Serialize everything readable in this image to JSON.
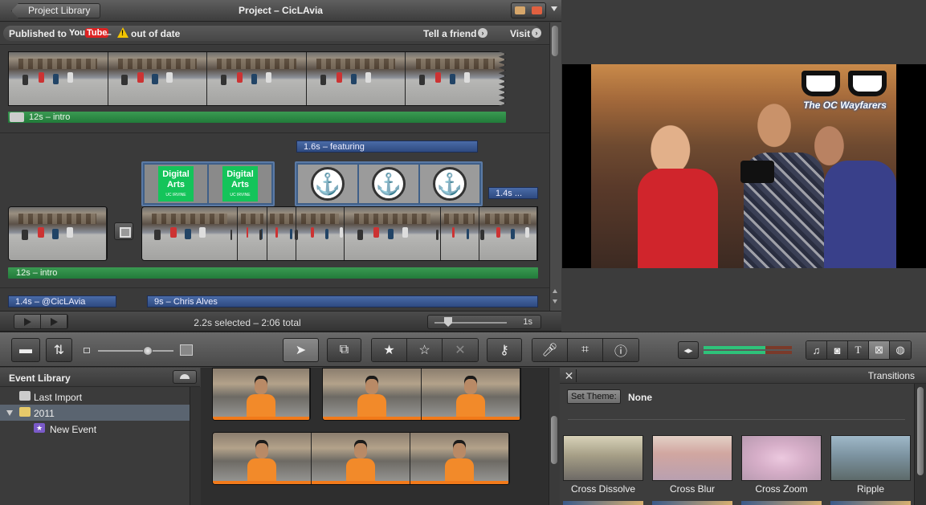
{
  "project": {
    "back_label": "Project Library",
    "title": "Project – CicLAvia",
    "published_to": "Published to",
    "youtube_you": "You",
    "youtube_tube": "Tube",
    "dash": "–",
    "status": "out of date",
    "tell_friend": "Tell a friend",
    "visit": "Visit"
  },
  "timeline": {
    "row1_clip": "12s – intro",
    "featuring": "1.6s – featuring",
    "short_clip": "1.4s ...",
    "row2_clip": "12s – intro",
    "title_left": "1.4s – @CicLAvia",
    "title_right": "9s – Chris Alves",
    "digital_arts_line1": "Digital",
    "digital_arts_line2": "Arts",
    "digital_arts_sub": "UC IRVINE"
  },
  "status_bar": {
    "selected": "2.2s selected – 2:06 total",
    "duration": "1s"
  },
  "viewer": {
    "logo_text": "The OC Wayfarers"
  },
  "event_library": {
    "title": "Event Library",
    "items": [
      {
        "label": "Last Import",
        "icon": "film-icon"
      },
      {
        "label": "2011",
        "icon": "calendar-icon"
      },
      {
        "label": "New Event",
        "icon": "star-icon"
      }
    ]
  },
  "transitions": {
    "title": "Transitions",
    "set_theme": "Set Theme:",
    "theme_value": "None",
    "items": [
      "Cross Dissolve",
      "Cross Blur",
      "Cross Zoom",
      "Ripple"
    ]
  },
  "colors": {
    "clip_green": "#2f8a47",
    "title_blue": "#3a5a94",
    "accent_selected": "#5a6470",
    "digital_arts_green": "#14c45a"
  }
}
